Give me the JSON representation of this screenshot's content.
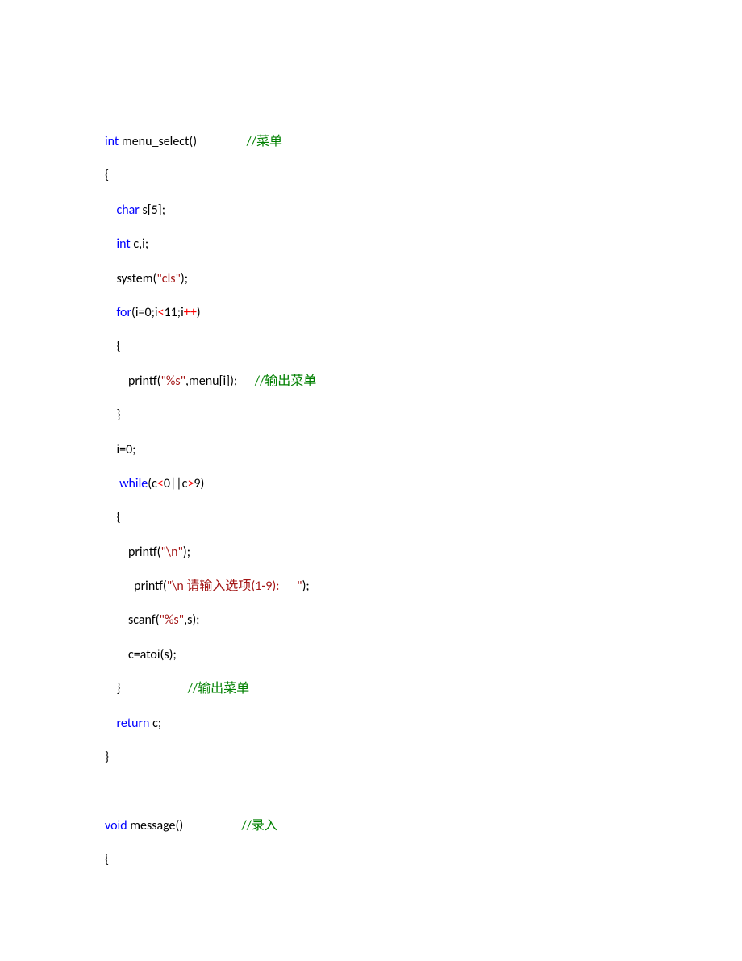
{
  "code": {
    "l1_kw": "int",
    "l1_id": " menu_select()                 ",
    "l1_cm": "//菜单",
    "l2": "{",
    "l3_kw": "char",
    "l3_rest": " s[5];",
    "l4_kw": "int",
    "l4_rest": " c,i;",
    "l5_fn": "    system(",
    "l5_str": "\"cls\"",
    "l5_end": ");",
    "l6_kw": "for",
    "l6_a": "(i=0;i",
    "l6_lt": "<",
    "l6_b": "11;i",
    "l6_pp": "++",
    "l6_c": ")",
    "l7": "    {",
    "l8_a": "        printf(",
    "l8_str": "\"%s\"",
    "l8_b": ",menu[i]);      ",
    "l8_cm": "//输出菜单",
    "l9": "    }",
    "l10": "    i=0;",
    "l11_kw": " while",
    "l11_a": "(c",
    "l11_lt": "<",
    "l11_b": "0||c",
    "l11_gt": ">",
    "l11_c": "9)",
    "l12": "    {",
    "l13_a": "        printf(",
    "l13_str": "\"\\n\"",
    "l13_b": ");",
    "l14_a": "          printf(",
    "l14_str": "\"\\n 请输入选项(1-9):      \"",
    "l14_b": ");",
    "l15_a": "        scanf(",
    "l15_str": "\"%s\"",
    "l15_b": ",s);",
    "l16": "        c=atoi(s);",
    "l17_a": "    }                       ",
    "l17_cm": "//输出菜单",
    "l18_kw": "return",
    "l18_rest": " c;",
    "l19": "}",
    "blank": "",
    "l20_kw": "void",
    "l20_id": " message()                    ",
    "l20_cm": "//录入",
    "l21": "{"
  }
}
